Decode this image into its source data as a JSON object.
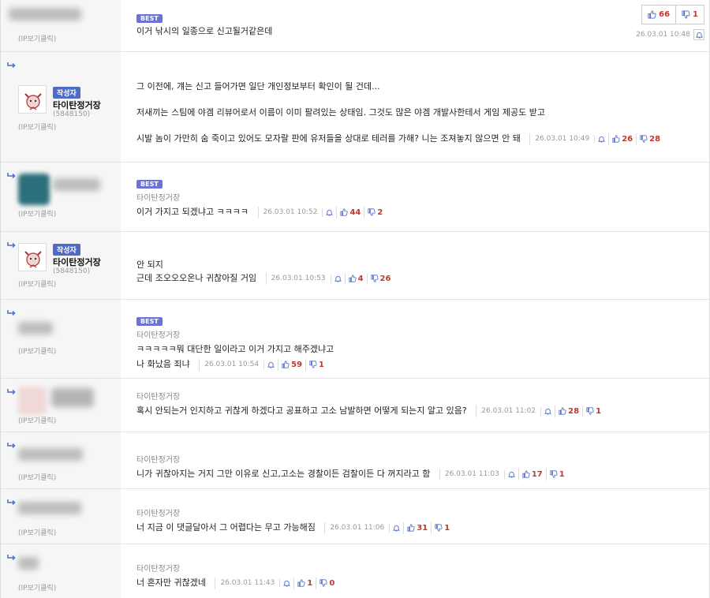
{
  "labels": {
    "ip": "(IP보기클릭)",
    "best": "BEST",
    "author_badge": "작성자"
  },
  "colors": {
    "accent_blue": "#4d6bc9",
    "best_badge": "#6b73d6",
    "vote_red": "#c0392b"
  },
  "comments": [
    {
      "text": "이거 낚시의 일종으로 신고될거같은데",
      "date": "26.03.01 10:48",
      "up": "66",
      "down": "1"
    },
    {
      "author_name": "타이탄정거장",
      "author_id": "(5848150)",
      "paragraphs": [
        "그 이전에, 걔는 신고 들어가면 일단 개인정보부터 확인이 될 건데...",
        "저새끼는 스팀에 야겜 리뷰어로서 이름이 이미 팔려있는 상태임. 그것도 많은 야겜 개발사한테서 게임 제공도 받고",
        "시발 놈이 가만히 숨 죽이고 있어도 모자랄 판에 유저들을 상대로 테러를 가해? 니는 조져놓지 않으면 안 돼"
      ],
      "date": "26.03.01 10:49",
      "up": "26",
      "down": "28"
    },
    {
      "meta_name": "타이탄정거장",
      "text": "이거 가지고 되겠냐고 ㅋㅋㅋㅋ",
      "date": "26.03.01 10:52",
      "up": "44",
      "down": "2"
    },
    {
      "author_name": "타이탄정거장",
      "author_id": "(5848150)",
      "line1": "안 되지",
      "line2": "근데 조오오오온나 귀찮아질 거임",
      "date": "26.03.01 10:53",
      "up": "4",
      "down": "26"
    },
    {
      "meta_name": "타이탄정거장",
      "line1": "ㅋㅋㅋㅋㅋ뭐 대단한 일이라고 이거 가지고 해주겠냐고",
      "line2": "나 화났음 죄냐",
      "date": "26.03.01 10:54",
      "up": "59",
      "down": "1"
    },
    {
      "meta_name": "타이탄정거장",
      "text": "혹시 안되는거 인지하고 귀찮게 하겠다고 공표하고 고소 남발하면 어떻게 되는지 알고 있음?",
      "date": "26.03.01 11:02",
      "up": "28",
      "down": "1"
    },
    {
      "meta_name": "타이탄정거장",
      "text": "니가 귀찮아지는 거지 그만 이유로 신고,고소는 경찰이든 검찰이든 다 꺼지라고 함",
      "date": "26.03.01 11:03",
      "up": "17",
      "down": "1"
    },
    {
      "meta_name": "타이탄정거장",
      "text": "너 지금 이 댓글달아서 그 어렵다는 무고 가능해짐",
      "date": "26.03.01 11:06",
      "up": "31",
      "down": "1"
    },
    {
      "meta_name": "타이탄정거장",
      "text": "너 혼자만 귀찮겠네",
      "date": "26.03.01 11:43",
      "up": "1",
      "down": "0"
    }
  ]
}
